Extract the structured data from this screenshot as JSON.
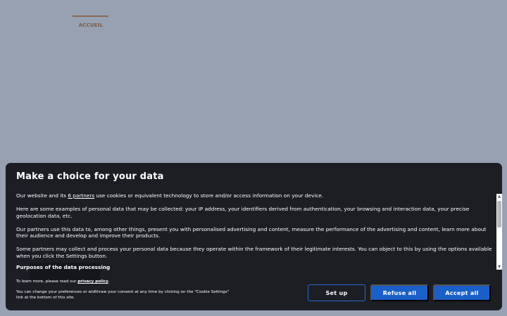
{
  "nav": {
    "home_label": "ACCUEIL"
  },
  "colors": {
    "page_background": "#97a1b2",
    "modal_background": "#1c1e24",
    "primary_button": "#1a5fc8",
    "nav_accent": "#8a6a52"
  },
  "consent": {
    "title": "Make a choice for your data",
    "intro_before_link": "Our website and its ",
    "partners_link": "6 partners",
    "intro_after_link": " use cookies or equivalent technology to store and/or access information on your device.",
    "examples": "Here are some examples of personal data that may be collected: your IP address, your identifiers derived from authentication, your browsing and interaction data, your precise geolocation data, etc.",
    "partners_use": "Our partners use this data to, among other things, present you with personalised advertising and content, measure the performance of the advertising and content, learn more about their audience and develop and improve their products.",
    "legitimate_interest": "Some partners may collect and process your personal data because they operate within the framework of their legitimate interests. You can object to this by using the options available when you click the Settings button.",
    "purposes_heading": "Purposes of the data processing",
    "learn_more_prefix": "To learn more, please read our ",
    "privacy_link": "privacy policy",
    "learn_more_suffix": ".",
    "change_text": "You can change your preferences or widthraw your consent at any time by clicking on the \"Cookie Settings\" link at the bottom of this site.",
    "buttons": {
      "setup": "Set up",
      "refuse": "Refuse all",
      "accept": "Accept all"
    }
  }
}
